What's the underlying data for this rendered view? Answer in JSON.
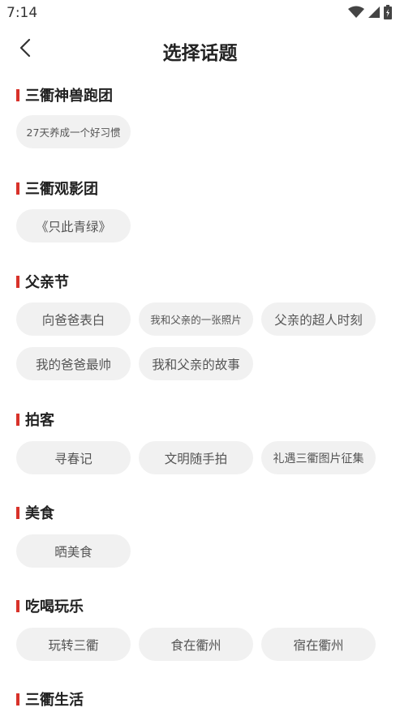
{
  "status_bar": {
    "time": "7:14",
    "icons": [
      "wifi-icon",
      "signal-icon",
      "battery-icon"
    ]
  },
  "header": {
    "title": "选择话题",
    "back_icon": "chevron-left-icon"
  },
  "colors": {
    "accent": "#d8322a",
    "chip_background": "#f1f1f1",
    "chip_text": "#555555",
    "title_text": "#222222"
  },
  "sections": [
    {
      "title": "三衢神兽跑团",
      "topics": [
        "27天养成一个好习惯"
      ]
    },
    {
      "title": "三衢观影团",
      "topics": [
        "《只此青绿》"
      ]
    },
    {
      "title": "父亲节",
      "topics": [
        "向爸爸表白",
        "我和父亲的一张照片",
        "父亲的超人时刻",
        "我的爸爸最帅",
        "我和父亲的故事"
      ]
    },
    {
      "title": "拍客",
      "topics": [
        "寻春记",
        "文明随手拍",
        "礼遇三衢图片征集"
      ]
    },
    {
      "title": "美食",
      "topics": [
        "晒美食"
      ]
    },
    {
      "title": "吃喝玩乐",
      "topics": [
        "玩转三衢",
        "食在衢州",
        "宿在衢州"
      ]
    },
    {
      "title": "三衢生活",
      "topics": []
    }
  ]
}
